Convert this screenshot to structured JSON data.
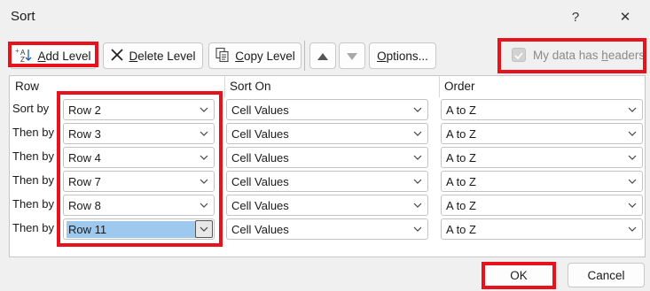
{
  "dialog": {
    "title": "Sort",
    "help_label": "?",
    "close_label": "✕"
  },
  "toolbar": {
    "add_level": {
      "mnemonic": "A",
      "rest": "dd Level"
    },
    "delete_level": {
      "mnemonic": "D",
      "rest": "elete Level"
    },
    "copy_level": {
      "mnemonic": "C",
      "rest": "opy Level"
    },
    "move_up_icon": "triangle-up",
    "move_down_icon": "triangle-down",
    "options": {
      "mnemonic": "O",
      "rest": "ptions..."
    },
    "headers_checkbox": {
      "label_pre": "My data has ",
      "mnemonic": "h",
      "label_post": "eaders",
      "checked": true,
      "disabled": true
    }
  },
  "columns": {
    "row": "Row",
    "sort_on": "Sort On",
    "order": "Order"
  },
  "levels": [
    {
      "label": "Sort by",
      "row": "Row 2",
      "sort_on": "Cell Values",
      "order": "A to Z"
    },
    {
      "label": "Then by",
      "row": "Row 3",
      "sort_on": "Cell Values",
      "order": "A to Z"
    },
    {
      "label": "Then by",
      "row": "Row 4",
      "sort_on": "Cell Values",
      "order": "A to Z"
    },
    {
      "label": "Then by",
      "row": "Row 7",
      "sort_on": "Cell Values",
      "order": "A to Z"
    },
    {
      "label": "Then by",
      "row": "Row 8",
      "sort_on": "Cell Values",
      "order": "A to Z"
    },
    {
      "label": "Then by",
      "row": "Row 11",
      "sort_on": "Cell Values",
      "order": "A to Z",
      "selected": true
    }
  ],
  "footer": {
    "ok": "OK",
    "cancel": "Cancel"
  },
  "colors": {
    "highlight": "#e8121c",
    "selection": "#9ec9ef"
  }
}
